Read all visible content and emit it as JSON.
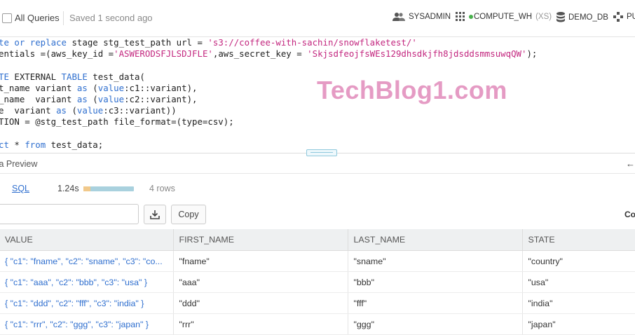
{
  "topbar": {
    "worksheet": "All Queries",
    "saved": "Saved 1 second ago",
    "role": "SYSADMIN",
    "warehouse": "COMPUTE_WH",
    "warehouse_size": "(XS)",
    "database": "DEMO_DB",
    "schema": "PU"
  },
  "editor": {
    "lines": [
      [
        [
          "kw",
          "te or replace "
        ],
        [
          "plain",
          "stage stg_test_path url = "
        ],
        [
          "str",
          "'s3://coffee-with-sachin/snowflaketest/'"
        ]
      ],
      [
        [
          "plain",
          "entials =(aws_key_id ="
        ],
        [
          "str",
          "'ASWERODSFJLSDJFLE'"
        ],
        [
          "plain",
          ",aws_secret_key = "
        ],
        [
          "str",
          "'SkjsdfeojfsWEs129dhsdkjfh8jdsddsmmsuwqQW'"
        ],
        [
          "plain",
          ");"
        ]
      ],
      [],
      [
        [
          "kw",
          "TE "
        ],
        [
          "plain",
          "EXTERNAL "
        ],
        [
          "kw",
          "TABLE "
        ],
        [
          "plain",
          "test_data("
        ]
      ],
      [
        [
          "plain",
          "t_name variant "
        ],
        [
          "kw",
          "as "
        ],
        [
          "plain",
          "("
        ],
        [
          "kw",
          "value"
        ],
        [
          "plain",
          ":c1::variant),"
        ]
      ],
      [
        [
          "plain",
          "_name  variant "
        ],
        [
          "kw",
          "as "
        ],
        [
          "plain",
          "("
        ],
        [
          "kw",
          "value"
        ],
        [
          "plain",
          ":c2::variant),"
        ]
      ],
      [
        [
          "plain",
          "e  variant "
        ],
        [
          "kw",
          "as "
        ],
        [
          "plain",
          "("
        ],
        [
          "kw",
          "value"
        ],
        [
          "plain",
          ":c3::variant))"
        ]
      ],
      [
        [
          "plain",
          "TION = @stg_test_path file_format=(type=csv);"
        ]
      ],
      [],
      [
        [
          "kw",
          "ct "
        ],
        [
          "plain",
          "* "
        ],
        [
          "kw",
          "from "
        ],
        [
          "plain",
          "test_data;"
        ]
      ]
    ]
  },
  "watermark": "TechBlog1.com",
  "preview": {
    "title": "ta Preview",
    "tab_sql": "SQL",
    "duration": "1.24s",
    "duration_bar_fraction": 0.14,
    "rows": "4 rows",
    "copy_label": "Copy",
    "right_label": "Co"
  },
  "table": {
    "columns": [
      "VALUE",
      "FIRST_NAME",
      "LAST_NAME",
      "STATE"
    ],
    "rows": [
      [
        "{ \"c1\": \"fname\", \"c2\": \"sname\", \"c3\": \"co...",
        "\"fname\"",
        "\"sname\"",
        "\"country\""
      ],
      [
        "{ \"c1\": \"aaa\", \"c2\": \"bbb\", \"c3\": \"usa\" }",
        "\"aaa\"",
        "\"bbb\"",
        "\"usa\""
      ],
      [
        "{ \"c1\": \"ddd\", \"c2\": \"fff\", \"c3\": \"india\" }",
        "\"ddd\"",
        "\"fff\"",
        "\"india\""
      ],
      [
        "{ \"c1\": \"rrr\", \"c2\": \"ggg\", \"c3\": \"japan\" }",
        "\"rrr\"",
        "\"ggg\"",
        "\"japan\""
      ]
    ]
  },
  "colors": {
    "keyword": "#2f6fcf",
    "string": "#c3277f",
    "watermark": "#e59bc4",
    "status_green": "#48b04c"
  },
  "icons": [
    "users-icon",
    "warehouse-grid-icon",
    "database-icon",
    "schema-icon",
    "download-icon",
    "arrow-left-icon"
  ]
}
